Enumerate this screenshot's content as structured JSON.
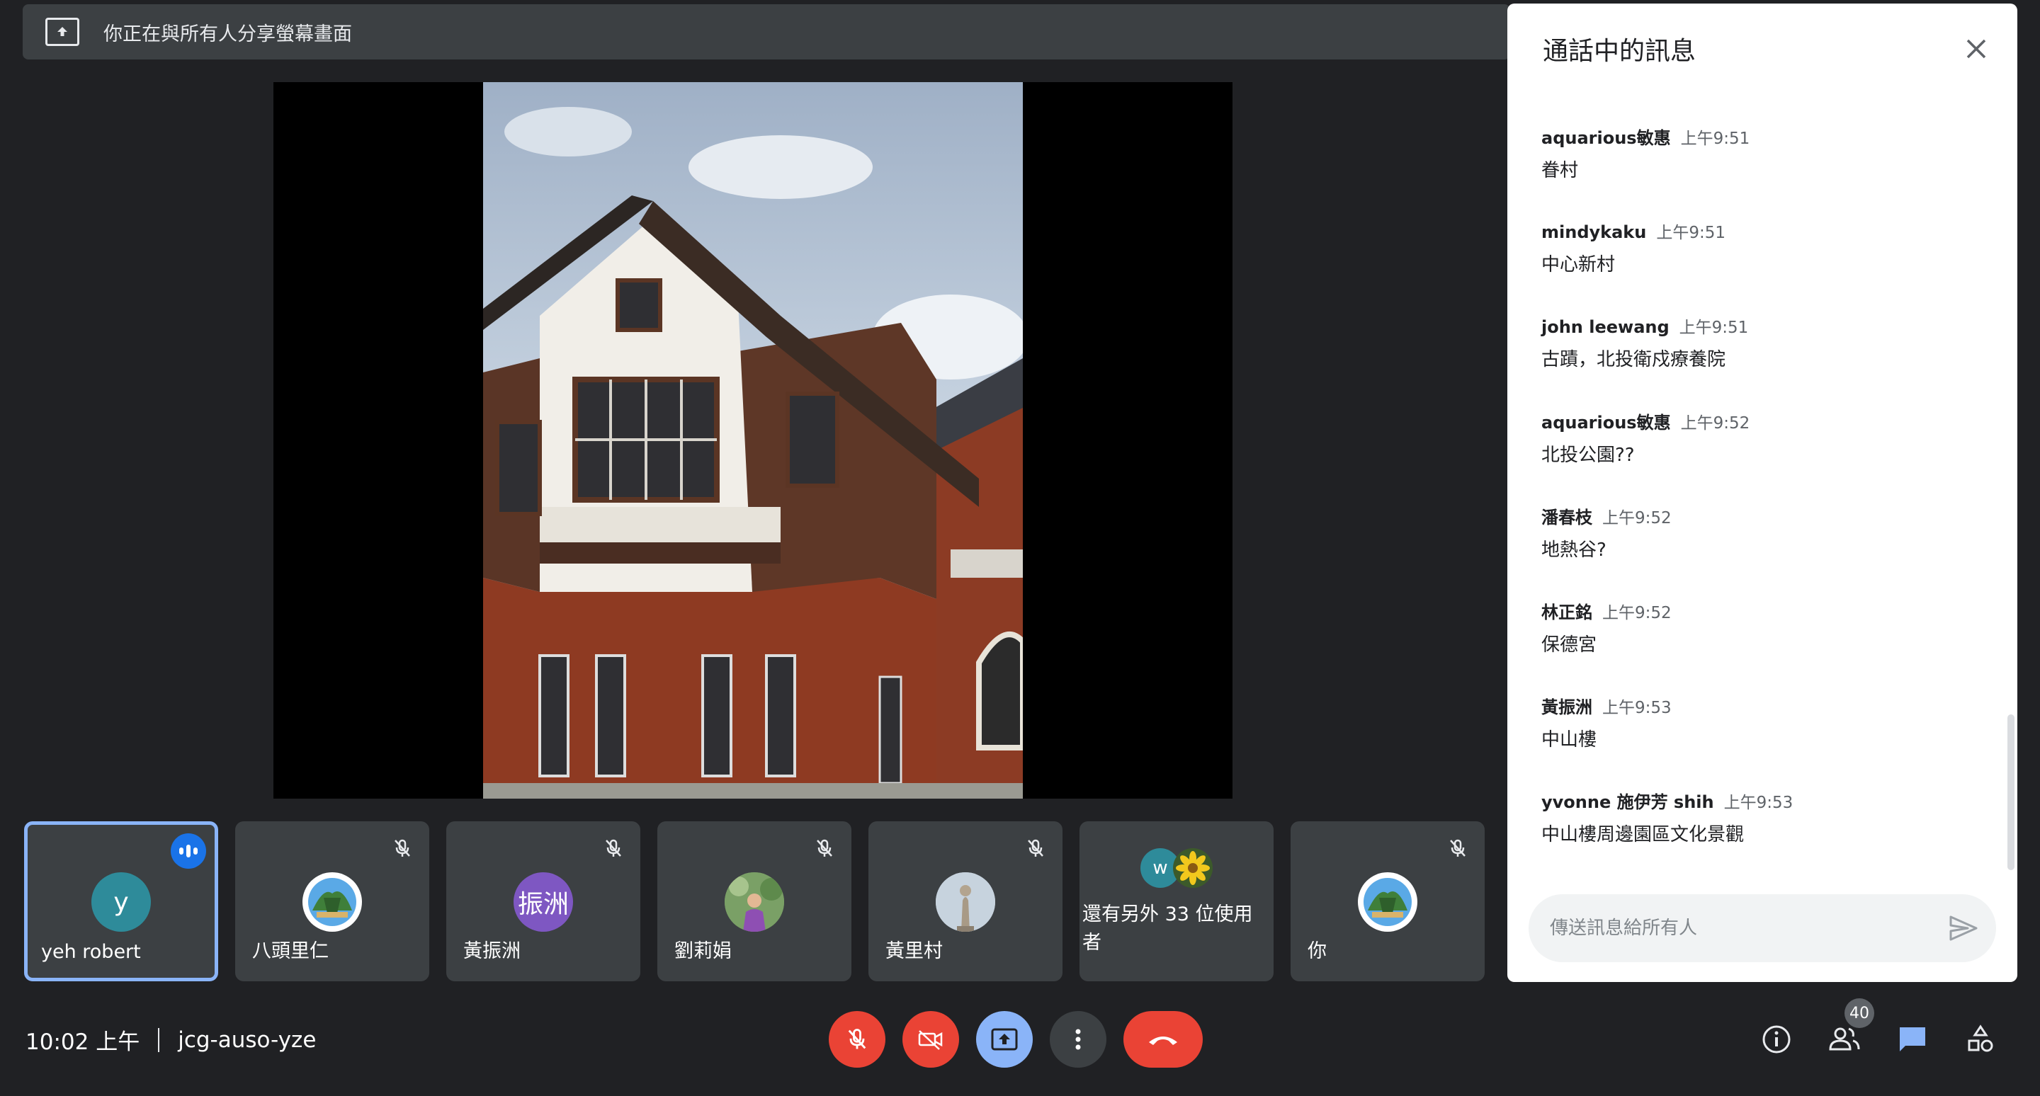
{
  "share_banner": {
    "text": "你正在與所有人分享螢幕畫面",
    "icon": "present-to-all-icon"
  },
  "tiles": [
    {
      "name": "yeh robert",
      "initial": "y",
      "avatar_color": "#2e8b9a",
      "status": "speaking"
    },
    {
      "name": "八頭里仁",
      "avatar": "picture",
      "status": "muted"
    },
    {
      "name": "黃振洲",
      "initial": "振洲",
      "avatar_color": "#7e57c2",
      "status": "muted"
    },
    {
      "name": "劉莉娟",
      "avatar": "picture",
      "status": "muted"
    },
    {
      "name": "黃里村",
      "avatar": "picture",
      "status": "muted"
    },
    {
      "more_text": "還有另外 33 位使用者",
      "initial": "w",
      "avatar_color": "#2e8b9a"
    },
    {
      "name": "你",
      "avatar": "picture",
      "status": "muted"
    }
  ],
  "chat": {
    "title": "通話中的訊息",
    "messages": [
      {
        "sender": "aquarious敏惠",
        "time": "上午9:51",
        "text": "眷村"
      },
      {
        "sender": "mindykaku",
        "time": "上午9:51",
        "text": "中心新村"
      },
      {
        "sender": "john leewang",
        "time": "上午9:51",
        "text": "古蹟，北投衛戍療養院"
      },
      {
        "sender": "aquarious敏惠",
        "time": "上午9:52",
        "text": "北投公園??"
      },
      {
        "sender": "潘春枝",
        "time": "上午9:52",
        "text": "地熱谷?"
      },
      {
        "sender": "林正銘",
        "time": "上午9:52",
        "text": "保德宮"
      },
      {
        "sender": "黃振洲",
        "time": "上午9:53",
        "text": "中山樓"
      },
      {
        "sender": "yvonne 施伊芳 shih",
        "time": "上午9:53",
        "text": "中山樓周邊園區文化景觀"
      }
    ],
    "input_placeholder": "傳送訊息給所有人"
  },
  "bottom": {
    "time": "10:02 上午",
    "meeting_code": "jcg-auso-yze",
    "participant_count": "40"
  },
  "colors": {
    "red": "#ea4335",
    "blue": "#8ab4f8",
    "surface": "#3c4043",
    "background": "#202124"
  }
}
